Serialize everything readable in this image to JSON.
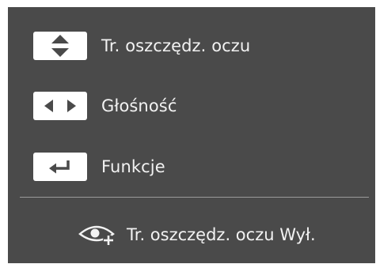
{
  "menu": {
    "items": [
      {
        "key_icon": "up-down-arrows-icon",
        "label": "Tr. oszczędz. oczu"
      },
      {
        "key_icon": "left-right-arrows-icon",
        "label": "Głośność"
      },
      {
        "key_icon": "enter-return-icon",
        "label": "Funkcje"
      }
    ]
  },
  "status": {
    "icon": "eye-saver-icon",
    "text": "Tr. oszczędz. oczu Wył."
  },
  "colors": {
    "panel": "#4a4a4a",
    "text": "#f2f2f2",
    "keycap": "#ffffff",
    "divider": "#9a9a9a"
  }
}
